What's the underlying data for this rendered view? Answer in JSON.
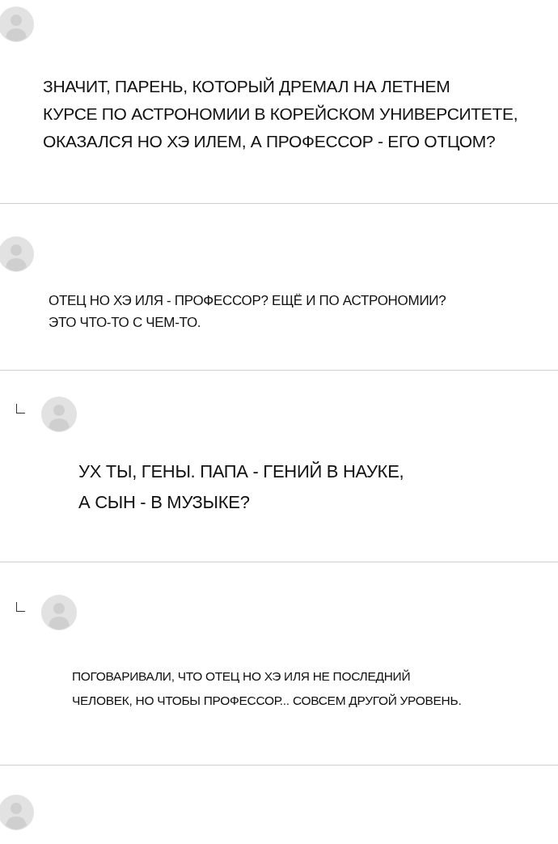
{
  "comments": [
    {
      "kind": "comment",
      "text": "ЗНАЧИТ, ПАРЕНЬ, КОТОРЫЙ ДРЕМАЛ НА ЛЕТНЕМ\nКУРСЕ ПО АСТРОНОМИИ В КОРЕЙСКОМ УНИВЕРСИТЕТЕ,\nОКАЗАЛСЯ НО ХЭ ИЛЕМ, А ПРОФЕССОР - ЕГО ОТЦОМ?"
    },
    {
      "kind": "comment",
      "text": "ОТЕЦ НО ХЭ ИЛЯ - ПРОФЕССОР? ЕЩЁ И ПО АСТРОНОМИИ?\nЭТО ЧТО-ТО С ЧЕМ-ТО."
    },
    {
      "kind": "reply",
      "text": "УХ ТЫ, ГЕНЫ. ПАПА - ГЕНИЙ В НАУКЕ,\nА СЫН - В МУЗЫКЕ?"
    },
    {
      "kind": "reply",
      "text": "ПОГОВАРИВАЛИ, ЧТО ОТЕЦ НО ХЭ ИЛЯ НЕ ПОСЛЕДНИЙ\nЧЕЛОВЕК, НО ЧТОБЫ ПРОФЕССОР... СОВСЕМ ДРУГОЙ УРОВЕНЬ."
    },
    {
      "kind": "comment"
    }
  ]
}
